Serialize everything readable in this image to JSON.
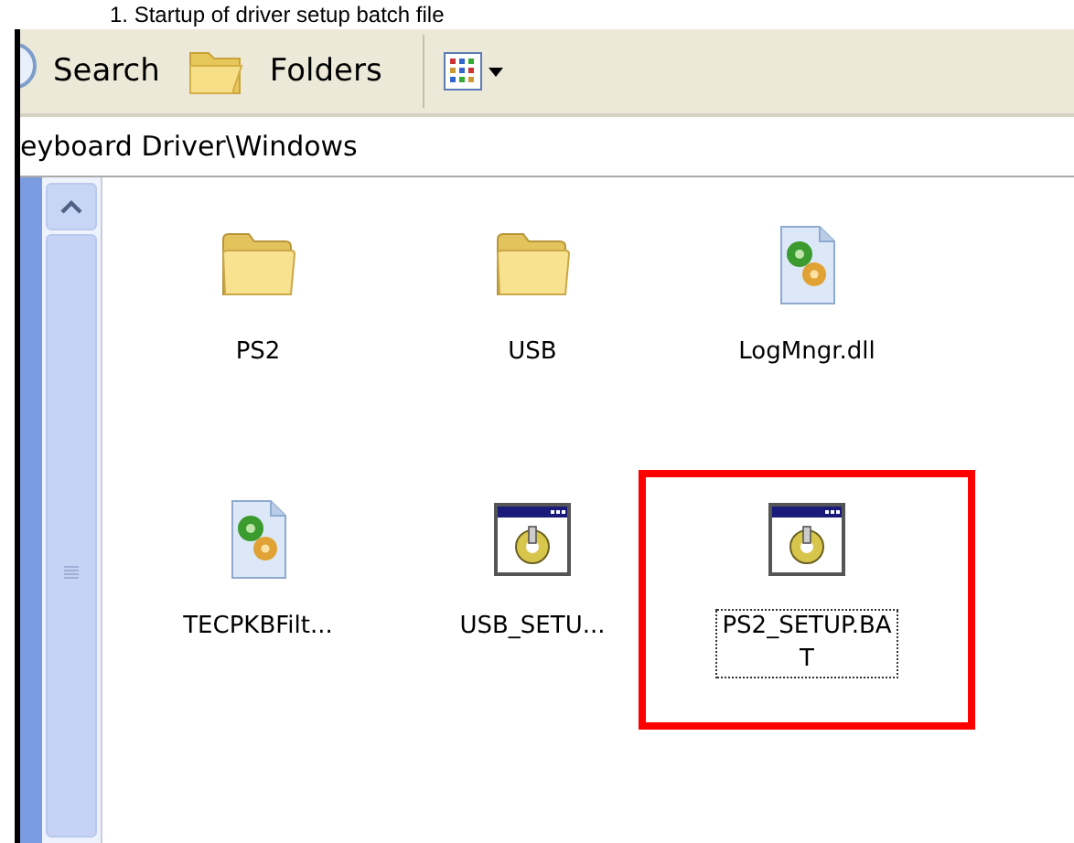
{
  "caption": "1. Startup of driver setup batch file",
  "toolbar": {
    "buttons": [
      {
        "kind": "search",
        "label": "Search"
      },
      {
        "kind": "folders",
        "label": "Folders"
      },
      {
        "kind": "views"
      }
    ]
  },
  "address": {
    "path": "eyboard Driver\\Windows"
  },
  "files": [
    {
      "kind": "folder",
      "name": "PS2",
      "selected": false,
      "highlighted": false
    },
    {
      "kind": "folder",
      "name": "USB",
      "selected": false,
      "highlighted": false
    },
    {
      "kind": "dll",
      "name": "LogMngr.dll",
      "selected": false,
      "highlighted": false
    },
    {
      "kind": "dll",
      "name": "TECPKBFilt...",
      "selected": false,
      "highlighted": false
    },
    {
      "kind": "bat",
      "name": "USB_SETU...",
      "selected": false,
      "highlighted": false
    },
    {
      "kind": "bat",
      "name": "PS2_SETUP.BAT",
      "selected": true,
      "highlighted": true
    }
  ]
}
